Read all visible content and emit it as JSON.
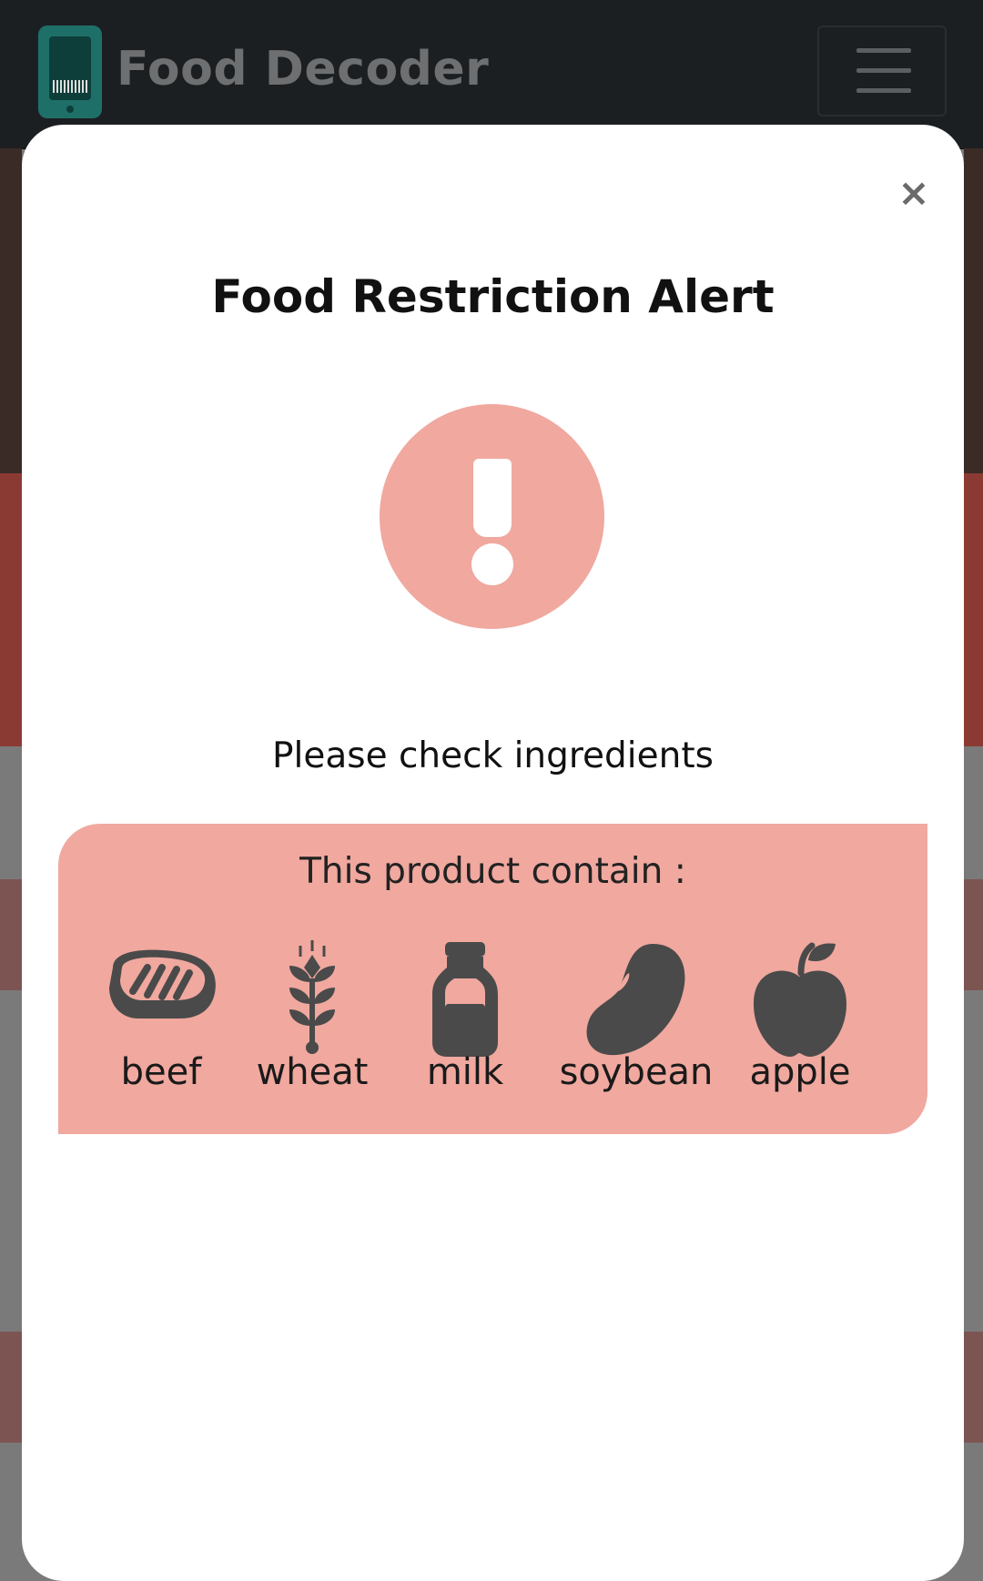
{
  "navbar": {
    "brand_title": "Food Decoder"
  },
  "modal": {
    "close_label": "×",
    "title": "Food Restriction Alert",
    "subtitle": "Please check ingredients",
    "contains_title": "This product contain :",
    "ingredients": [
      {
        "label": "beef",
        "icon": "steak-icon"
      },
      {
        "label": "wheat",
        "icon": "wheat-icon"
      },
      {
        "label": "milk",
        "icon": "milk-bottle-icon"
      },
      {
        "label": "soybean",
        "icon": "bean-icon"
      },
      {
        "label": "apple",
        "icon": "apple-icon"
      }
    ]
  },
  "colors": {
    "navbar_bg": "#1c1f22",
    "brand_accent": "#1f6f69",
    "alert_pink": "#f0a89f",
    "icon_dark": "#4a4a4a",
    "overlay": "#7a7a7a"
  }
}
